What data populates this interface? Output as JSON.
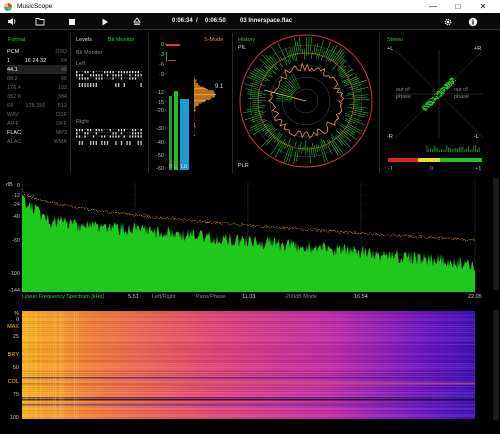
{
  "window": {
    "title": "MusicScope"
  },
  "toolbar": {
    "time_elapsed": "0:06:34",
    "time_sep": "/",
    "time_total": "0:06:50",
    "filename": "03 Innerspace.flac"
  },
  "format": {
    "title": "Format",
    "rows": [
      {
        "left": "PCM",
        "mid": "",
        "right": "DSD"
      },
      {
        "left": "1",
        "mid": "16   24   32",
        "right": "64"
      },
      {
        "left": "44.1",
        "mid": "",
        "right": "48"
      },
      {
        "left": "88.2",
        "mid": "",
        "right": "96"
      },
      {
        "left": "176.4",
        "mid": "",
        "right": "192"
      },
      {
        "left": "352.8",
        "mid": "",
        "right": "384"
      },
      {
        "left": "64",
        "mid": "128  256",
        "right": "512"
      },
      {
        "left": "WAV",
        "mid": "",
        "right": "DSF"
      },
      {
        "left": "AIFF",
        "mid": "",
        "right": "DFF"
      },
      {
        "left": "FLAC",
        "mid": "",
        "right": "MP3"
      },
      {
        "left": "ALAC",
        "mid": "",
        "right": "WMA"
      }
    ]
  },
  "levels": {
    "title": "Levels",
    "bit_monitor": "Bit Monitor",
    "left": "Left",
    "right": "Right",
    "s_mode": "S-Mode",
    "scale": [
      "0",
      "-3",
      "-6",
      "-9",
      "-12",
      "-15",
      "-20",
      "-30",
      "-40",
      "-50",
      "-60"
    ],
    "peak_value": "9.1",
    "ch_labels": [
      "R",
      "L",
      "LU"
    ]
  },
  "history": {
    "title": "History",
    "pil": "PIL",
    "plr": "PLR"
  },
  "stereo": {
    "title": "Stereo",
    "plus_l": "+L",
    "plus_r": "+R",
    "minus_l": "-L",
    "minus_r": "-R",
    "out_of_phase": "out of phase",
    "scale_min": "-1",
    "scale_mid": "0",
    "scale_max": "+1"
  },
  "spectrum": {
    "y_ticks": [
      "dB",
      "0",
      "-12",
      "-24",
      "-40",
      "-60",
      "-100",
      "-144"
    ],
    "x_labels": [
      "Linear Frequency Spectrum [kHz]",
      "5.51",
      "Left/Right",
      "Pans/Phase",
      "11.03",
      "-200dB Mode",
      "16.54",
      "22.05"
    ]
  },
  "spectrogram": {
    "y_ticks": [
      "%",
      "0",
      "MAX",
      "25",
      "BRY",
      "50",
      "COL",
      "75",
      "100"
    ]
  },
  "colors": {
    "accent_green": "#28d028",
    "accent_orange": "#e89428",
    "meter_blue": "#1e9ad0",
    "spectrum_green": "#1fc81f"
  }
}
